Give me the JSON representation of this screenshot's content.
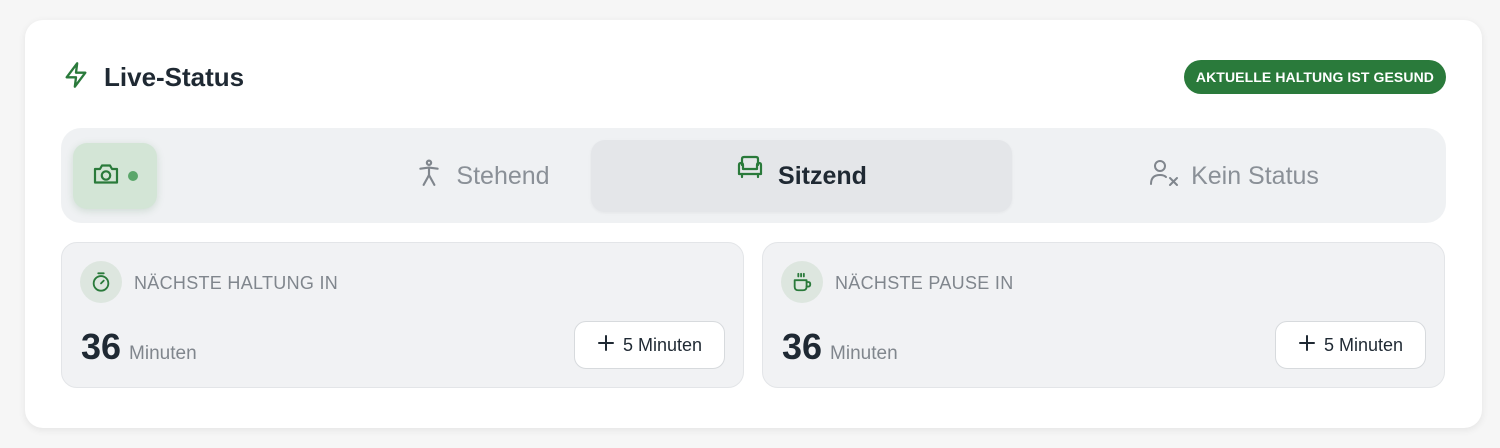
{
  "header": {
    "title": "Live-Status",
    "icon": "lightning-icon"
  },
  "badge": {
    "label": "AKTUELLE HALTUNG IST GESUND",
    "color": "#2a7a3b"
  },
  "status_selector": {
    "camera": {
      "icon": "camera-icon",
      "indicator": "active"
    },
    "options": [
      {
        "label": "Stehend",
        "icon": "standing-person-icon",
        "active": false
      },
      {
        "label": "Sitzend",
        "icon": "armchair-icon",
        "active": true
      },
      {
        "label": "Kein Status",
        "icon": "person-x-icon",
        "active": false
      }
    ]
  },
  "panels": [
    {
      "label": "NÄCHSTE HALTUNG IN",
      "icon": "stopwatch-icon",
      "value": "36",
      "unit": "Minuten",
      "button_label": "5 Minuten"
    },
    {
      "label": "NÄCHSTE PAUSE IN",
      "icon": "coffee-cup-icon",
      "value": "36",
      "unit": "Minuten",
      "button_label": "5 Minuten"
    }
  ],
  "colors": {
    "accent": "#2a7a3b",
    "muted": "#80868d"
  }
}
